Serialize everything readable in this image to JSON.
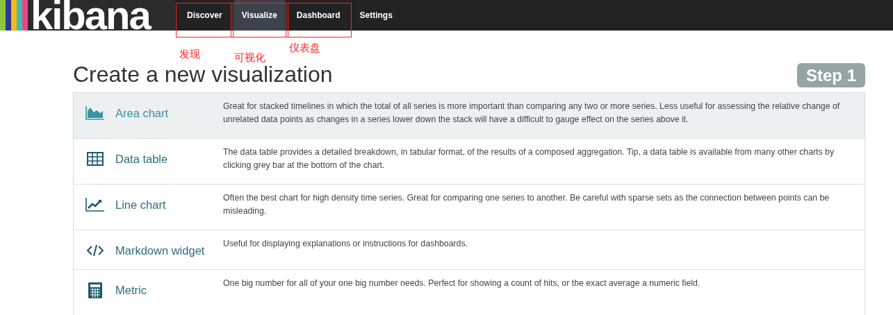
{
  "logo": {
    "text": "kibana"
  },
  "nav": [
    {
      "label": "Discover",
      "selected": false,
      "annotation": "发现"
    },
    {
      "label": "Visualize",
      "selected": true,
      "annotation": "可视化"
    },
    {
      "label": "Dashboard",
      "selected": false,
      "annotation": "仪表盘"
    },
    {
      "label": "Settings",
      "selected": false
    }
  ],
  "page": {
    "title": "Create a new visualization",
    "step": "Step 1"
  },
  "visualizations": [
    {
      "kind": "area",
      "name": "Area chart",
      "selected": true,
      "description": "Great for stacked timelines in which the total of all series is more important than comparing any two or more series. Less useful for assessing the relative change of unrelated data points as changes in a series lower down the stack will have a difficult to gauge effect on the series above it."
    },
    {
      "kind": "table",
      "name": "Data table",
      "selected": false,
      "description": "The data table provides a detailed breakdown, in tabular format, of the results of a composed aggregation. Tip, a data table is available from many other charts by clicking grey bar at the bottom of the chart."
    },
    {
      "kind": "line",
      "name": "Line chart",
      "selected": false,
      "description": "Often the best chart for high density time series. Great for comparing one series to another. Be careful with sparse sets as the connection between points can be misleading."
    },
    {
      "kind": "code",
      "name": "Markdown widget",
      "selected": false,
      "description": "Useful for displaying explanations or instructions for dashboards."
    },
    {
      "kind": "calc",
      "name": "Metric",
      "selected": false,
      "description": "One big number for all of your one big number needs. Perfect for showing a count of hits, or the exact average a numeric field."
    }
  ]
}
